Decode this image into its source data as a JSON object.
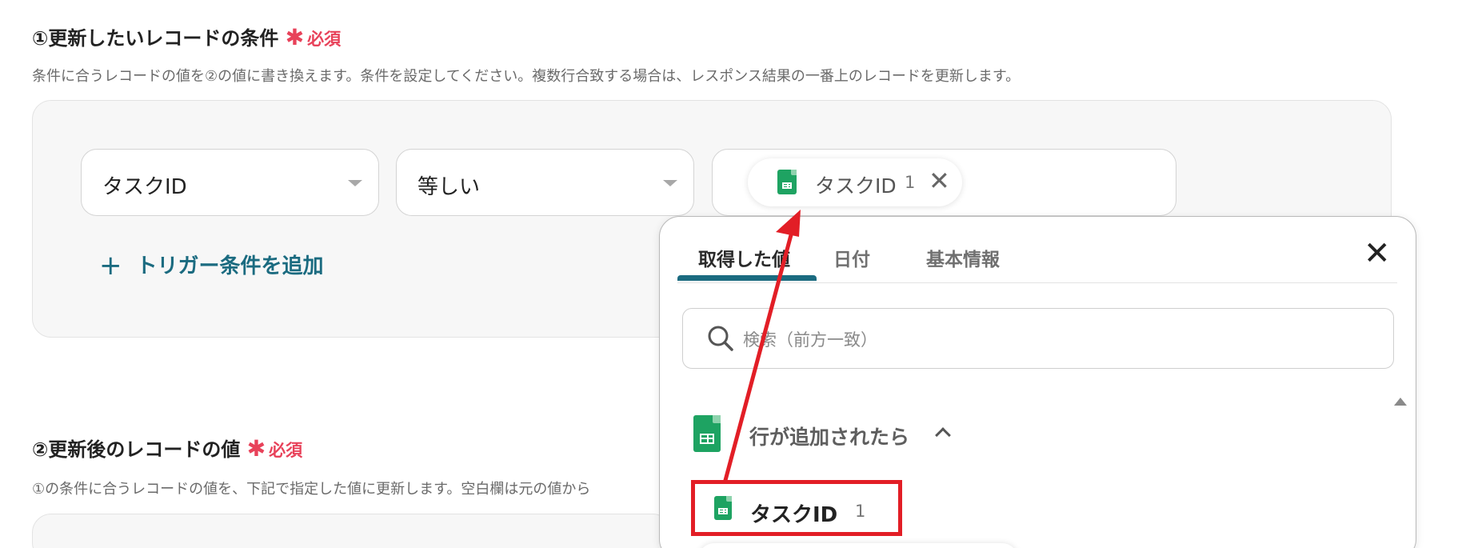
{
  "section1": {
    "title": "①更新したいレコードの条件",
    "required_mark": "✱",
    "required_label": "必須",
    "description": "条件に合うレコードの値を②の値に書き換えます。条件を設定してください。複数行合致する場合は、レスポンス結果の一番上のレコードを更新します。"
  },
  "condition": {
    "field_value": "タスクID",
    "operator_value": "等しい",
    "value_chip": {
      "label": "タスクID",
      "count": "1",
      "remove_icon": "✕",
      "icon": "google-sheets-icon"
    },
    "add_link": {
      "plus": "+",
      "label": "トリガー条件を追加"
    }
  },
  "section2": {
    "title": "②更新後のレコードの値",
    "required_mark": "✱",
    "required_label": "必須",
    "description": "①の条件に合うレコードの値を、下記で指定した値に更新します。空白欄は元の値から"
  },
  "popup": {
    "tabs": [
      {
        "label": "取得した値",
        "active": true
      },
      {
        "label": "日付",
        "active": false
      },
      {
        "label": "基本情報",
        "active": false
      }
    ],
    "close_icon": "✕",
    "search_placeholder": "検索（前方一致）",
    "group": {
      "title": "行が追加されたら",
      "icon": "google-sheets-icon",
      "expanded": true
    },
    "items": [
      {
        "label": "タスクID",
        "count": "1",
        "icon": "google-sheets-icon",
        "highlighted": true
      }
    ]
  },
  "annotation": {
    "arrow_color": "#e21e26",
    "highlight_color": "#e21e26"
  },
  "colors": {
    "accent": "#1b6b80",
    "required": "#e8425a",
    "sheets_green": "#1ea362"
  }
}
